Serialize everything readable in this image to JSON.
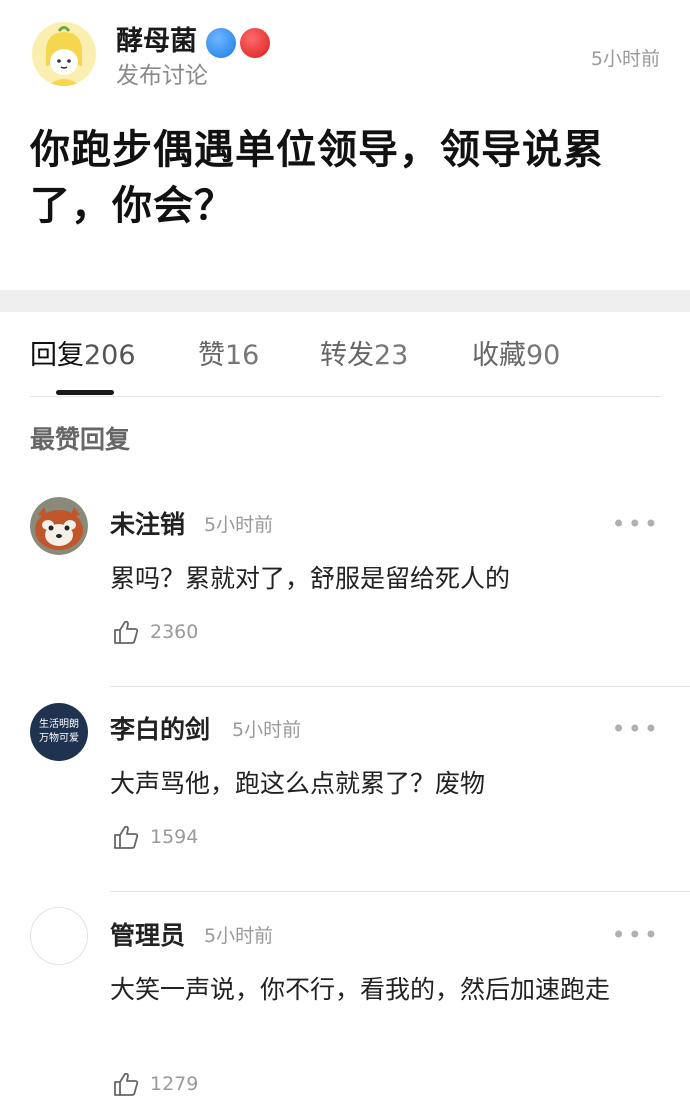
{
  "post": {
    "author": "酵母菌",
    "action": "发布讨论",
    "time": "5小时前",
    "title": "你跑步偶遇单位领导，领导说累了，你会？"
  },
  "tabs": [
    {
      "label": "回复",
      "count": "206"
    },
    {
      "label": "赞",
      "count": "16"
    },
    {
      "label": "转发",
      "count": "23"
    },
    {
      "label": "收藏",
      "count": "90"
    }
  ],
  "section_label": "最赞回复",
  "comments": [
    {
      "name": "未注销",
      "time": "5小时前",
      "text": "累吗？累就对了，舒服是留给死人的",
      "likes": "2360",
      "avatar_icon": "red-panda-avatar"
    },
    {
      "name": "李白的剑",
      "time": "5小时前",
      "text": "大声骂他，跑这么点就累了？废物",
      "likes": "1594",
      "avatar_icon": "text-avatar",
      "avatar_text_1": "生活明朗",
      "avatar_text_2": "万物可爱"
    },
    {
      "name": "管理员",
      "time": "5小时前",
      "text": "大笑一声说，你不行，看我的，然后加速跑走",
      "likes": "1279",
      "avatar_icon": "blank-avatar"
    }
  ],
  "more_glyph": "•••",
  "colors": {
    "badge_blue": "#1f7be6",
    "badge_red": "#d91c1c",
    "divider": "#efefef"
  }
}
